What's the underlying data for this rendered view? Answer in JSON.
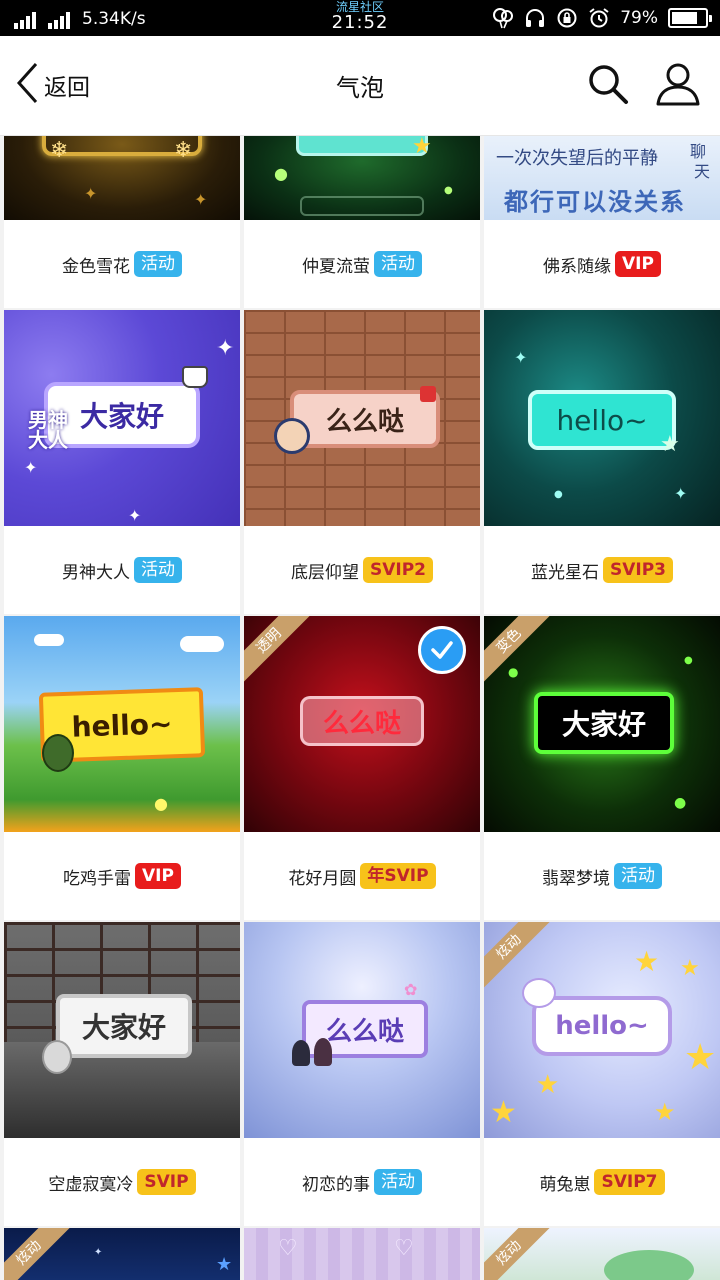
{
  "status_bar": {
    "speed": "5.34K/s",
    "carrier": "流星社区",
    "time": "21:52",
    "battery": "79%",
    "battery_level": 0.79
  },
  "header": {
    "back_label": "返回",
    "title": "气泡"
  },
  "rows": [
    [
      {
        "name": "金色雪花",
        "badge": "活动",
        "badge_type": "act"
      },
      {
        "name": "仲夏流萤",
        "badge": "活动",
        "badge_type": "act"
      },
      {
        "name": "佛系随缘",
        "badge": "VIP",
        "badge_type": "vip",
        "thumb_text": [
          "一次次失望后的平静",
          "都行可以没关系",
          "聊",
          "天"
        ]
      }
    ],
    [
      {
        "name": "男神大人",
        "badge": "活动",
        "badge_type": "act",
        "bubble": "大家好",
        "side_text": "男神大人"
      },
      {
        "name": "底层仰望",
        "badge": "SVIP2",
        "badge_type": "svip",
        "bubble": "么么哒"
      },
      {
        "name": "蓝光星石",
        "badge": "SVIP3",
        "badge_type": "svip",
        "bubble": "hello~"
      }
    ],
    [
      {
        "name": "吃鸡手雷",
        "badge": "VIP",
        "badge_type": "vip",
        "bubble": "hello~"
      },
      {
        "name": "花好月圆",
        "badge": "年SVIP",
        "badge_type": "svip",
        "bubble": "么么哒",
        "ribbon": "透明",
        "selected": true
      },
      {
        "name": "翡翠梦境",
        "badge": "活动",
        "badge_type": "act",
        "bubble": "大家好",
        "ribbon": "变色"
      }
    ],
    [
      {
        "name": "空虚寂寞冷",
        "badge": "SVIP",
        "badge_type": "svip",
        "bubble": "大家好"
      },
      {
        "name": "初恋的事",
        "badge": "活动",
        "badge_type": "act",
        "bubble": "么么哒"
      },
      {
        "name": "萌兔崽",
        "badge": "SVIP7",
        "badge_type": "svip",
        "bubble": "hello~",
        "ribbon": "炫动"
      }
    ],
    [
      {
        "ribbon": "炫动"
      },
      {},
      {
        "ribbon": "炫动"
      }
    ]
  ]
}
